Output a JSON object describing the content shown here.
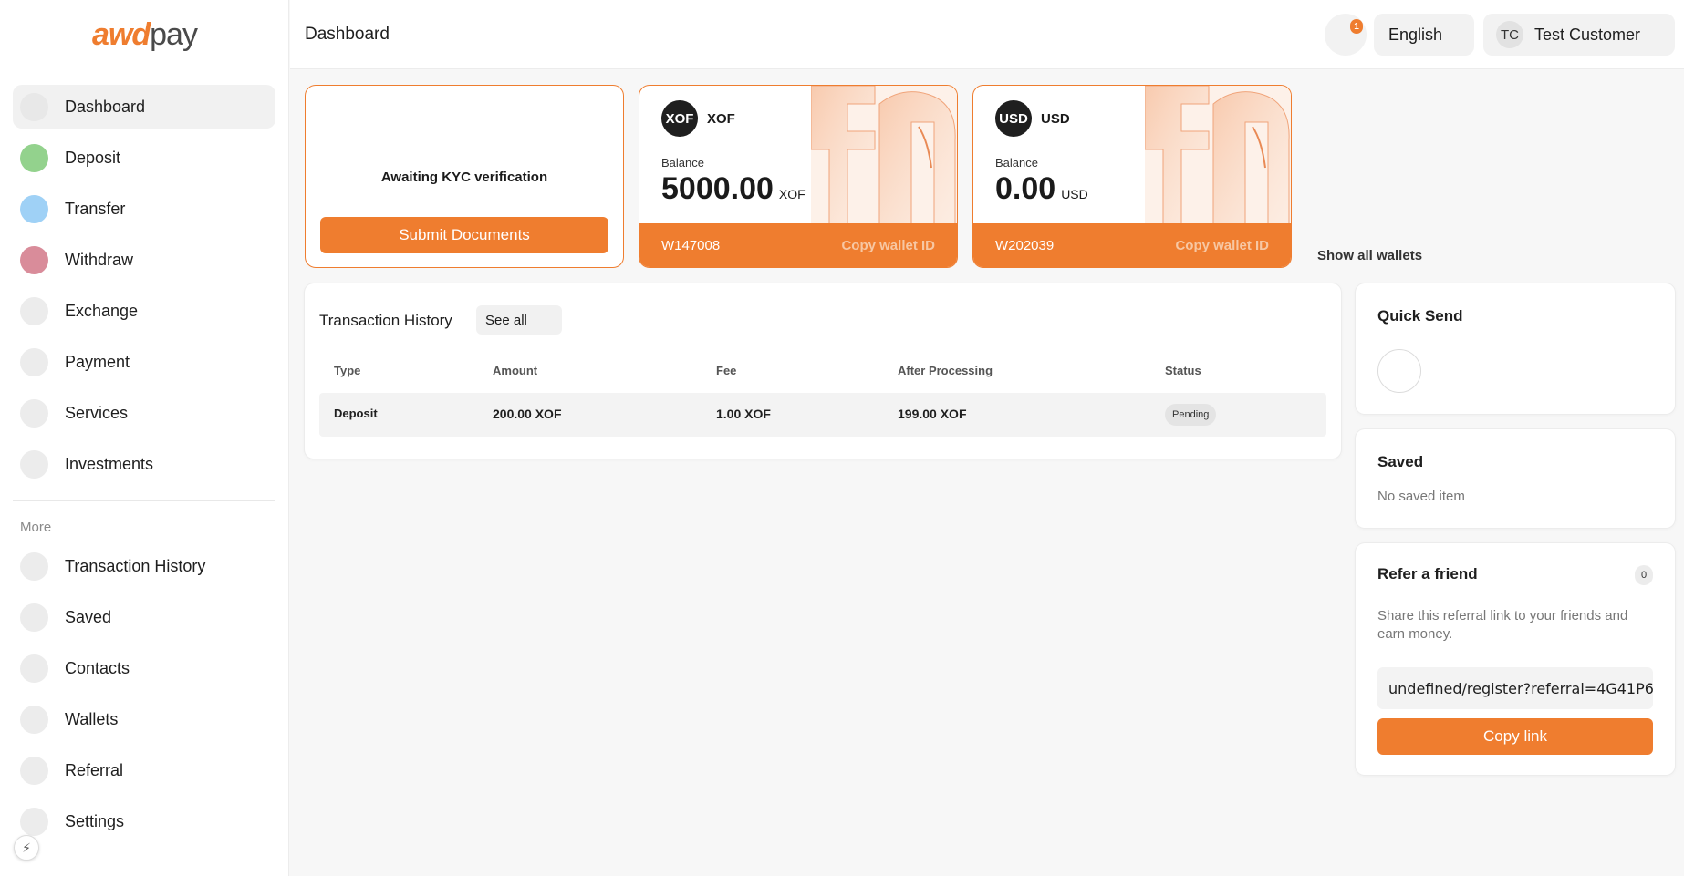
{
  "brand": {
    "logo_accent": "awd",
    "logo_rest": "pay",
    "accent_color": "#ef7d2f"
  },
  "header": {
    "title": "Dashboard",
    "notification_count": "1",
    "language": "English",
    "user_initials": "TC",
    "user_name": "Test Customer"
  },
  "sidebar": {
    "items": [
      {
        "label": "Dashboard",
        "icon": "dashboard-icon",
        "color": "#e8e8e8",
        "active": true
      },
      {
        "label": "Deposit",
        "icon": "deposit-icon",
        "color": "#93d28d"
      },
      {
        "label": "Transfer",
        "icon": "transfer-icon",
        "color": "#9fd1f6"
      },
      {
        "label": "Withdraw",
        "icon": "withdraw-icon",
        "color": "#d98c9a"
      },
      {
        "label": "Exchange",
        "icon": "exchange-icon",
        "color": "#ececec"
      },
      {
        "label": "Payment",
        "icon": "payment-icon",
        "color": "#ececec"
      },
      {
        "label": "Services",
        "icon": "services-icon",
        "color": "#ececec"
      },
      {
        "label": "Investments",
        "icon": "investments-icon",
        "color": "#ececec"
      }
    ],
    "more_title": "More",
    "more_items": [
      {
        "label": "Transaction History",
        "icon": "history-icon"
      },
      {
        "label": "Saved",
        "icon": "saved-icon"
      },
      {
        "label": "Contacts",
        "icon": "contacts-icon"
      },
      {
        "label": "Wallets",
        "icon": "wallets-icon"
      },
      {
        "label": "Referral",
        "icon": "referral-icon"
      },
      {
        "label": "Settings",
        "icon": "settings-icon"
      }
    ]
  },
  "kyc": {
    "message": "Awaiting KYC verification",
    "button_label": "Submit Documents"
  },
  "wallets": [
    {
      "badge": "XOF",
      "code": "XOF",
      "balance_label": "Balance",
      "amount": "5000.00",
      "unit": "XOF",
      "wallet_id": "W147008",
      "copy_label": "Copy wallet ID"
    },
    {
      "badge": "USD",
      "code": "USD",
      "balance_label": "Balance",
      "amount": "0.00",
      "unit": "USD",
      "wallet_id": "W202039",
      "copy_label": "Copy wallet ID"
    }
  ],
  "show_all_wallets": "Show all wallets",
  "transactions": {
    "title": "Transaction History",
    "see_all": "See all",
    "columns": [
      "Type",
      "Amount",
      "Fee",
      "After Processing",
      "Status"
    ],
    "rows": [
      {
        "type": "Deposit",
        "amount": "200.00 XOF",
        "fee": "1.00 XOF",
        "after": "199.00 XOF",
        "status": "Pending"
      }
    ]
  },
  "quick_send": {
    "title": "Quick Send"
  },
  "saved": {
    "title": "Saved",
    "empty": "No saved item"
  },
  "referral": {
    "title": "Refer a friend",
    "count": "0",
    "description": "Share this referral link to your friends and earn money.",
    "link": "undefined/register?referral=4G41P6",
    "button_label": "Copy link"
  }
}
